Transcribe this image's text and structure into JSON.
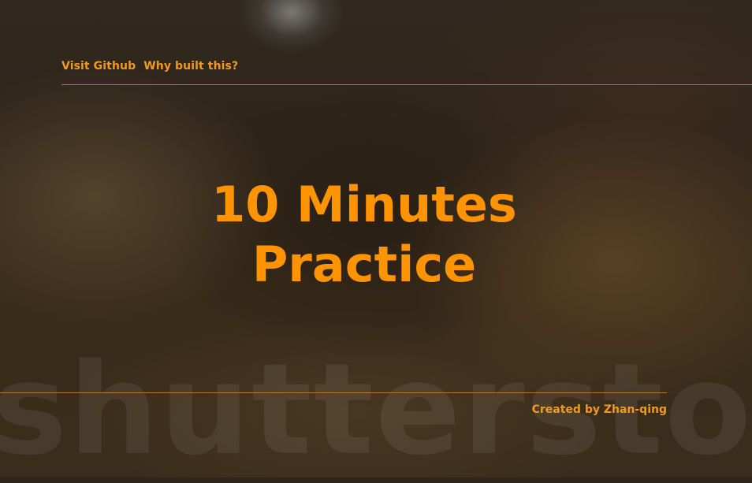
{
  "nav": {
    "links": [
      {
        "label": "Visit Github"
      },
      {
        "label": "Why built this?"
      }
    ]
  },
  "hero": {
    "title_line1": "10 Minutes",
    "title_line2": "Practice"
  },
  "footer": {
    "credit": "Created by Zhan-qing"
  },
  "watermark": {
    "text": "shutterstock"
  },
  "colors": {
    "accent": "#ff9300",
    "link": "#f19a22",
    "rule": "#b9771f"
  }
}
